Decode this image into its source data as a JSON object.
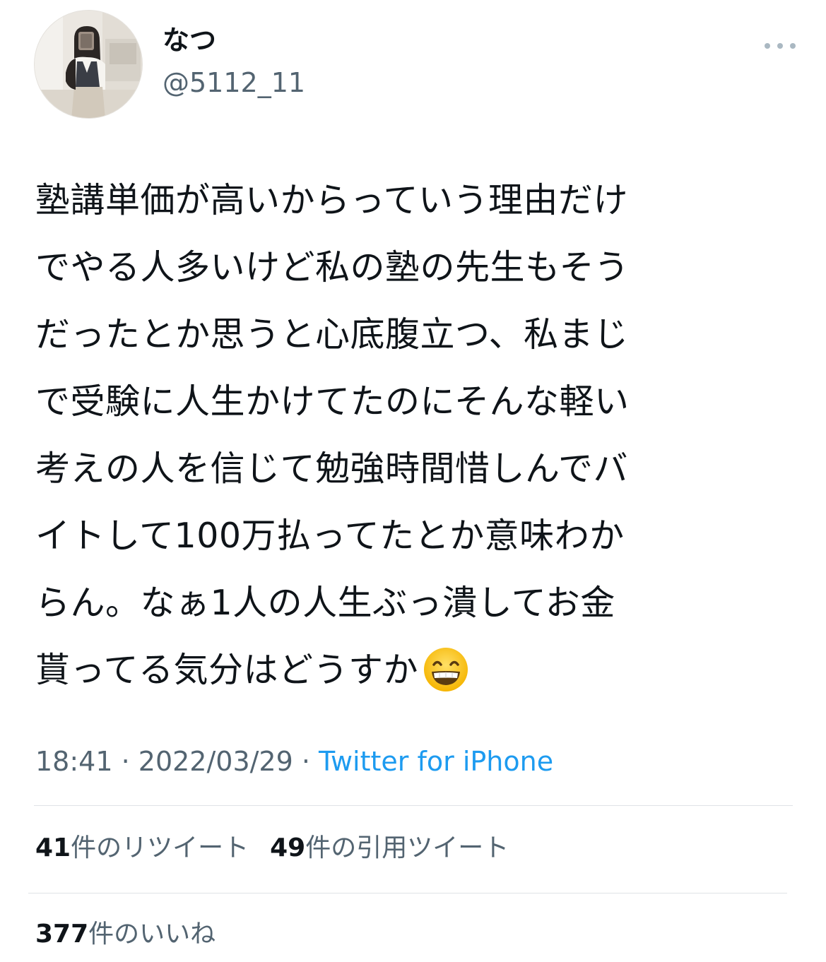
{
  "author": {
    "display_name": "なつ",
    "handle": "@5112_11",
    "avatar_icon": "profile-photo"
  },
  "more_icon": "more-horizontal-icon",
  "tweet": {
    "text": "塾講単価が高いからっていう理由だけでやる人多いけど私の塾の先生もそうだったとか思うと心底腹立つ、私まじで受験に人生かけてたのにそんな軽い考えの人を信じて勉強時間惜しんでバイトして100万払ってたとか意味わからん。なぁ1人の人生ぶっ潰してお金貰ってる気分はどうすか",
    "lines": [
      "塾講単価が高いからっていう理由だけ",
      "でやる人多いけど私の塾の先生もそう",
      "だったとか思うと心底腹立つ、私まじ",
      "で受験に人生かけてたのにそんな軽い",
      "考えの人を信じて勉強時間惜しんでバ",
      "イトして100万払ってたとか意味わか",
      "らん。なぁ1人の人生ぶっ潰してお金",
      "貰ってる気分はどうすか"
    ],
    "emoji": "grinning-face-with-smiling-eyes"
  },
  "meta": {
    "time": "18:41",
    "separator": " · ",
    "date": "2022/03/29",
    "source": "Twitter for iPhone"
  },
  "stats": {
    "retweets_count": "41",
    "retweets_label": "件のリツイート",
    "quotes_count": "49",
    "quotes_label": "件の引用ツイート",
    "likes_count": "377",
    "likes_label": "件のいいね"
  },
  "colors": {
    "text_primary": "#0f1419",
    "text_secondary": "#536471",
    "link": "#1d9bf0",
    "divider": "#dfe3e6"
  }
}
